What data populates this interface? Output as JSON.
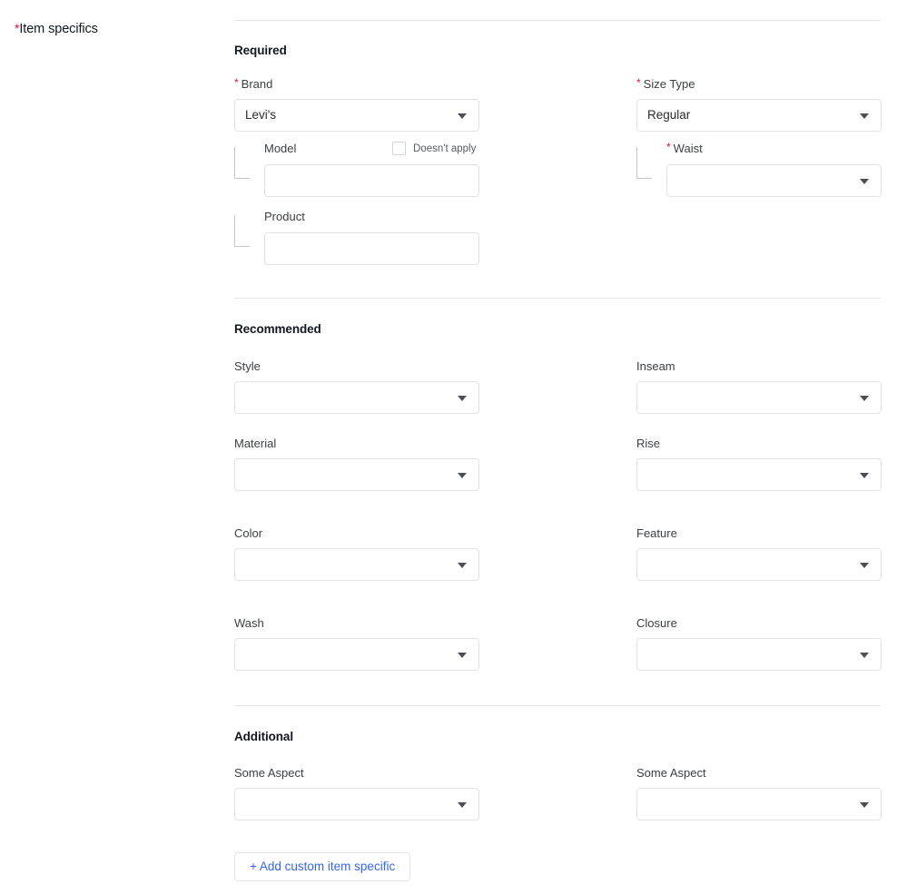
{
  "page": {
    "left_rail": {
      "required_marker": "*",
      "title": "Item specifics"
    },
    "groups": [
      {
        "id": "required",
        "heading": "Required"
      },
      {
        "id": "recommended",
        "heading": "Recommended"
      },
      {
        "id": "additional",
        "heading": "Additional"
      }
    ],
    "fields": {
      "brand": {
        "required_marker": "*",
        "label": "Brand",
        "value": "Levi's",
        "icon": "chevron-down-icon"
      },
      "size_type": {
        "required_marker": "*",
        "label": "Size Type",
        "value": "Regular",
        "icon": "chevron-down-icon"
      },
      "model": {
        "label": "Model",
        "value": "",
        "placeholder": "",
        "doesnt_apply_label": "Doesn't apply",
        "doesnt_apply_checked": false
      },
      "waist": {
        "required_marker": "*",
        "label": "Waist",
        "value": "",
        "icon": "chevron-down-icon"
      },
      "product": {
        "label": "Product",
        "value": "",
        "placeholder": ""
      },
      "style": {
        "label": "Style",
        "value": "",
        "icon": "chevron-down-icon"
      },
      "inseam": {
        "label": "Inseam",
        "value": "",
        "icon": "chevron-down-icon"
      },
      "material": {
        "label": "Material",
        "value": "",
        "icon": "chevron-down-icon"
      },
      "rise": {
        "label": "Rise",
        "value": "",
        "icon": "chevron-down-icon"
      },
      "color": {
        "label": "Color",
        "value": "",
        "icon": "chevron-down-icon"
      },
      "feature": {
        "label": "Feature",
        "value": "",
        "icon": "chevron-down-icon"
      },
      "wash": {
        "label": "Wash",
        "value": "",
        "icon": "chevron-down-icon"
      },
      "closure": {
        "label": "Closure",
        "value": "",
        "icon": "chevron-down-icon"
      },
      "some_aspect_left": {
        "label": "Some Aspect",
        "value": "",
        "icon": "chevron-down-icon"
      },
      "some_aspect_right": {
        "label": "Some Aspect",
        "value": "",
        "icon": "chevron-down-icon"
      }
    },
    "actions": {
      "add_custom_item_specific": "+ Add custom item specific"
    },
    "colors": {
      "required_asterisk": "#e0103a",
      "link_blue": "#3665f3",
      "border_gray": "#e2e2e2",
      "divider_gray": "#e5e5e5",
      "label_gray": "#3c4043",
      "text_dark": "#111820"
    }
  }
}
